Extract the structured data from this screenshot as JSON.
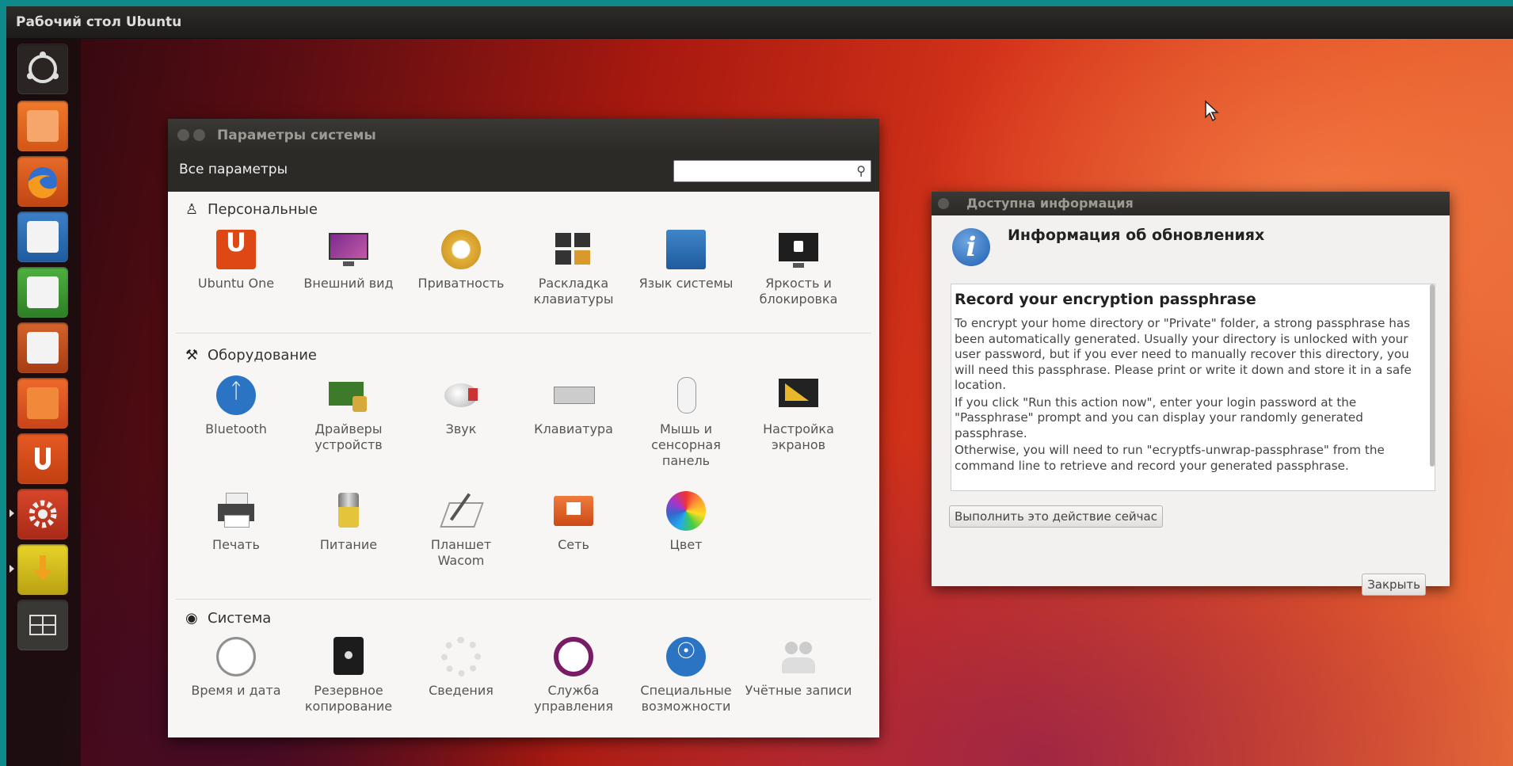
{
  "topbar": {
    "title": "Рабочий стол Ubuntu"
  },
  "launcher": {
    "items": [
      {
        "name": "dash-home",
        "color": "#2a2522"
      },
      {
        "name": "files",
        "color": "#e8661c"
      },
      {
        "name": "firefox",
        "color": "#d55a1e"
      },
      {
        "name": "writer",
        "color": "#2f6fb7"
      },
      {
        "name": "calc",
        "color": "#3d9a34"
      },
      {
        "name": "impress",
        "color": "#c2521f"
      },
      {
        "name": "software-center",
        "color": "#e0501c"
      },
      {
        "name": "ubuntu-one",
        "color": "#dd4814"
      },
      {
        "name": "system-settings",
        "color": "#c43622"
      },
      {
        "name": "updates",
        "color": "#d9c41a"
      },
      {
        "name": "workspaces",
        "color": "#3a3834"
      }
    ]
  },
  "settings": {
    "title": "Параметры системы",
    "all_settings": "Все параметры",
    "search_placeholder": "",
    "sections": {
      "personal": {
        "label": "Персональные",
        "items": [
          "Ubuntu One",
          "Внешний вид",
          "Приватность",
          "Раскладка клавиатуры",
          "Язык системы",
          "Яркость и блокировка"
        ]
      },
      "hardware": {
        "label": "Оборудование",
        "items": [
          "Bluetooth",
          "Драйверы устройств",
          "Звук",
          "Клавиатура",
          "Мышь и сенсорная панель",
          "Настройка экранов",
          "Печать",
          "Питание",
          "Планшет Wacom",
          "Сеть",
          "Цвет"
        ]
      },
      "system": {
        "label": "Система",
        "items": [
          "Время и дата",
          "Резервное копирование",
          "Сведения",
          "Служба управления",
          "Специальные возможности",
          "Учётные записи"
        ]
      }
    }
  },
  "info_dialog": {
    "title": "Доступна информация",
    "heading": "Информация об обновлениях",
    "text_title": "Record your encryption passphrase",
    "paragraphs": [
      "To encrypt your home directory or \"Private\" folder, a strong passphrase has been automatically generated. Usually your directory is unlocked with your user password, but if you ever need to manually recover this directory, you will need this passphrase. Please print or write it down and store it in a safe location.",
      "If you click \"Run this action now\", enter your login password at the \"Passphrase\" prompt and you can display your randomly generated passphrase.",
      "Otherwise, you will need to run \"ecryptfs-unwrap-passphrase\" from the command line to retrieve and record your generated passphrase."
    ],
    "run_button": "Выполнить это действие сейчас",
    "close_button": "Закрыть"
  }
}
